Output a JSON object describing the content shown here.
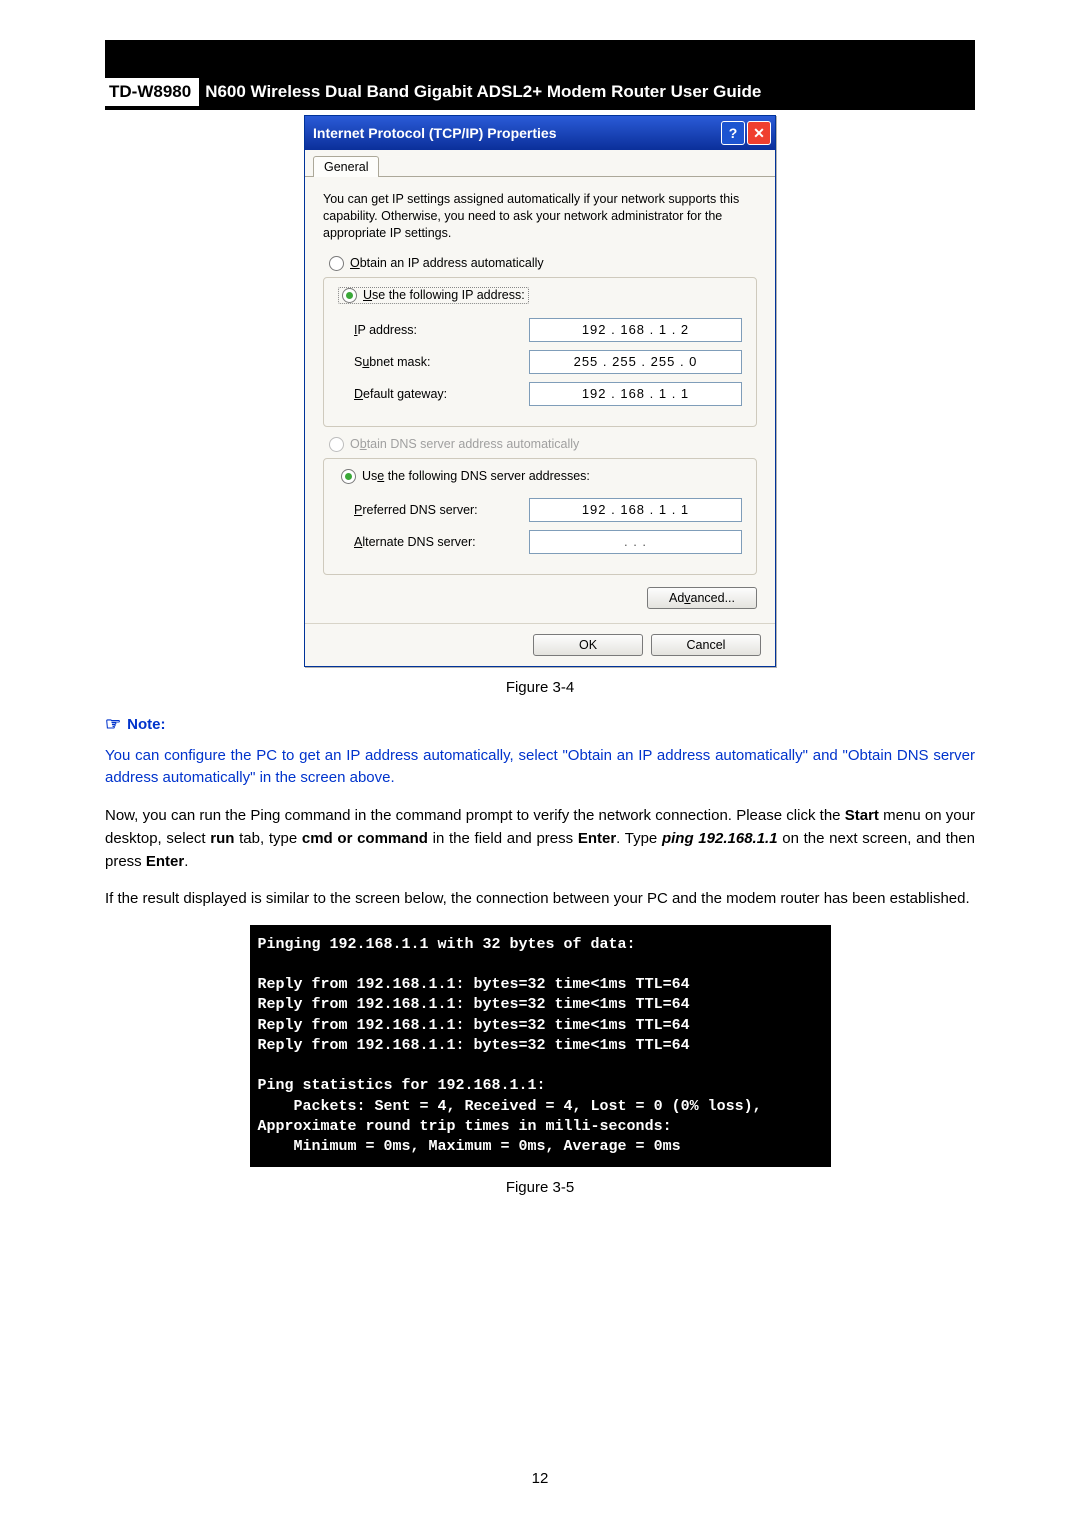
{
  "header": {
    "model": "TD-W8980",
    "title": "N600 Wireless Dual Band Gigabit ADSL2+ Modem Router User Guide"
  },
  "dialog": {
    "title": "Internet Protocol (TCP/IP) Properties",
    "help_glyph": "?",
    "close_glyph": "✕",
    "tab": "General",
    "desc": "You can get IP settings assigned automatically if your network supports this capability. Otherwise, you need to ask your network administrator for the appropriate IP settings.",
    "ip_auto_label_pre": "O",
    "ip_auto_label_post": "btain an IP address automatically",
    "ip_manual_label_pre": "U",
    "ip_manual_label_post": "se the following IP address:",
    "ip_addr_label_pre": "I",
    "ip_addr_label_post": "P address:",
    "ip_addr_value": "192 . 168 .  1  .  2",
    "subnet_label_pre": "S",
    "subnet_label_mid": "u",
    "subnet_label_post": "bnet mask:",
    "subnet_value": "255 . 255 . 255 .  0",
    "gateway_label_pre": "D",
    "gateway_label_post": "efault gateway:",
    "gateway_value": "192 . 168 .  1  .  1",
    "dns_auto_label_pre": "O",
    "dns_auto_label_mid": "b",
    "dns_auto_label_post": "tain DNS server address automatically",
    "dns_manual_label_pre": "Us",
    "dns_manual_label_mid": "e",
    "dns_manual_label_post": " the following DNS server addresses:",
    "pref_dns_label_pre": "P",
    "pref_dns_label_post": "referred DNS server:",
    "pref_dns_value": "192 . 168 .  1  .  1",
    "alt_dns_label_pre": "A",
    "alt_dns_label_post": "lternate DNS server:",
    "alt_dns_value": ".       .       .",
    "advanced_label_pre": "Ad",
    "advanced_label_mid": "v",
    "advanced_label_post": "anced...",
    "ok_label": "OK",
    "cancel_label": "Cancel"
  },
  "fig34": "Figure 3-4",
  "note_heading": "Note:",
  "note_para": "You can configure the PC to get an IP address automatically, select \"Obtain an IP address automatically\" and \"Obtain DNS server address automatically\" in the screen above.",
  "para2_a": "Now, you can run the Ping command in the command prompt to verify the network connection. Please click the ",
  "para2_start": "Start",
  "para2_b": " menu on your desktop, select ",
  "para2_run": "run",
  "para2_c": " tab, type ",
  "para2_cmd": "cmd or command",
  "para2_d": " in the field and press ",
  "para2_enter1": "Enter",
  "para2_e": ". Type ",
  "para2_ping": "ping 192.168.1.1",
  "para2_f": " on the next screen, and then press ",
  "para2_enter2": "Enter",
  "para2_g": ".",
  "para3": "If the result displayed is similar to the screen below, the connection between your PC and the modem router has been established.",
  "console": "Pinging 192.168.1.1 with 32 bytes of data:\n\nReply from 192.168.1.1: bytes=32 time<1ms TTL=64\nReply from 192.168.1.1: bytes=32 time<1ms TTL=64\nReply from 192.168.1.1: bytes=32 time<1ms TTL=64\nReply from 192.168.1.1: bytes=32 time<1ms TTL=64\n\nPing statistics for 192.168.1.1:\n    Packets: Sent = 4, Received = 4, Lost = 0 (0% loss),\nApproximate round trip times in milli-seconds:\n    Minimum = 0ms, Maximum = 0ms, Average = 0ms",
  "fig35": "Figure 3-5",
  "page_number": "12"
}
